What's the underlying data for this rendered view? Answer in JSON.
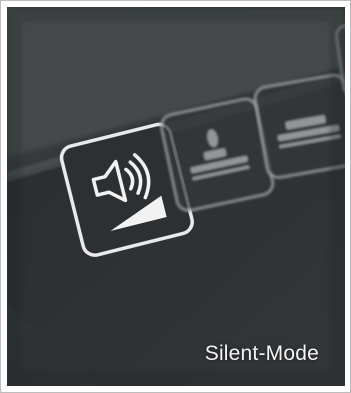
{
  "image": {
    "subject": "control-panel-buttons",
    "caption": "Silent-Mode"
  },
  "buttons": [
    {
      "icon": "speaker-volume-icon",
      "state": "lit"
    },
    {
      "icon": "steam-iron-icon",
      "state": "dim"
    },
    {
      "icon": "iron-base-icon",
      "state": "dim"
    },
    {
      "icon": "partial-button-icon",
      "state": "dim"
    }
  ],
  "colors": {
    "panel": "#2f3235",
    "bezel": "#3d4044",
    "icon_lit": "#f2f2f2",
    "icon_dim": "#8a8d90"
  }
}
